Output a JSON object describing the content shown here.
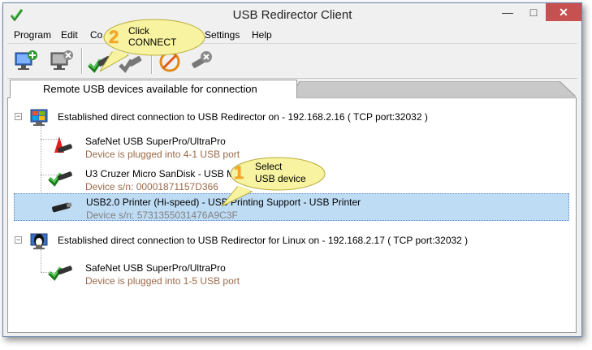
{
  "window": {
    "title": "USB Redirector Client"
  },
  "titlebar": {
    "min_glyph": "—",
    "max_glyph": "□",
    "close_glyph": "✕"
  },
  "menu": [
    "Program",
    "Edit",
    "Co",
    "Settings",
    "Help"
  ],
  "toolbar": {
    "buttons": [
      "add-server-icon",
      "remove-server-icon",
      "connect-device-icon",
      "disconnect-device-icon",
      "autoconnect-off-icon",
      "remove-device-icon"
    ]
  },
  "tabs": {
    "active": "Remote USB devices available for connection"
  },
  "tree": {
    "hosts": [
      {
        "label": "Established direct connection to USB Redirector on - 192.168.2.16 ( TCP port:32032 )",
        "icon": "windows-server-icon",
        "expander": "−",
        "devices": [
          {
            "name": "SafeNet USB SuperPro/UltraPro",
            "sub": "Device is plugged into 4-1 USB port",
            "icon": "usb-key-red-icon"
          },
          {
            "name": "U3 Cruzer Micro SanDisk - USB M",
            "sub": "Device s/n: 00001871157D366",
            "icon": "usb-flash-icon"
          },
          {
            "name": "USB2.0 Printer (Hi-speed) - USB Printing Support - USB Printer",
            "sub": "Device s/n: 5731355031476A9C3F",
            "icon": "usb-printer-icon",
            "selected": true
          }
        ]
      },
      {
        "label": "Established direct connection to USB Redirector for Linux on - 192.168.2.17 ( TCP port:32032 )",
        "icon": "linux-server-icon",
        "expander": "−",
        "devices": [
          {
            "name": "SafeNet USB SuperPro/UltraPro",
            "sub": "Device is plugged into 1-5 USB port",
            "icon": "usb-key-green-icon"
          }
        ]
      }
    ]
  },
  "callouts": [
    {
      "number": "2",
      "line1": "Click",
      "line2": "CONNECT"
    },
    {
      "number": "1",
      "line1": "Select",
      "line2": "USB device"
    }
  ],
  "colors": {
    "selection": "#bfdcf5",
    "callout_fill": "#f7f3a0",
    "callout_number": "#f5a623",
    "device_sub": "#9a6b4a",
    "close_button": "#c75050"
  }
}
